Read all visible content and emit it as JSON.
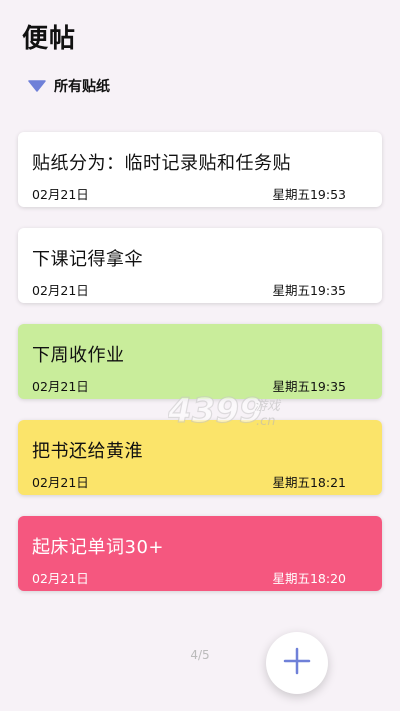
{
  "header": {
    "title": "便帖"
  },
  "filter": {
    "label": "所有贴纸",
    "icon": "triangle-down-icon",
    "icon_color": "#6f80d8"
  },
  "notes": [
    {
      "text": "贴纸分为：临时记录贴和任务贴",
      "date": "02月21日",
      "time": "星期五19:53",
      "color": "#ffffff",
      "text_color": "#111111"
    },
    {
      "text": "下课记得拿伞",
      "date": "02月21日",
      "time": "星期五19:35",
      "color": "#ffffff",
      "text_color": "#111111"
    },
    {
      "text": "下周收作业",
      "date": "02月21日",
      "time": "星期五19:35",
      "color": "#c9ed9b",
      "text_color": "#111111"
    },
    {
      "text": "把书还给黄淮",
      "date": "02月21日",
      "time": "星期五18:21",
      "color": "#fbe46a",
      "text_color": "#111111"
    },
    {
      "text": "起床记单词30+",
      "date": "02月21日",
      "time": "星期五18:20",
      "color": "#f5577f",
      "text_color": "#ffffff"
    }
  ],
  "pager": {
    "text": "4/5"
  },
  "fab": {
    "icon": "plus-icon",
    "icon_color": "#6f80d8"
  },
  "watermark": {
    "text": "4399游戏",
    "domain": ".cn"
  }
}
